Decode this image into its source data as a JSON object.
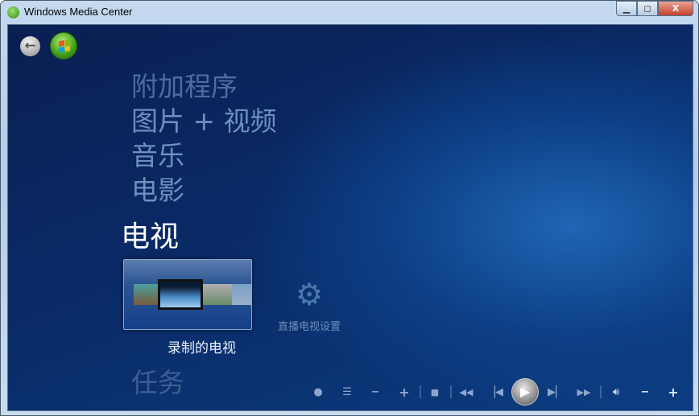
{
  "window": {
    "title": "Windows Media Center",
    "controls": {
      "minimize": "▭",
      "maximize": "□",
      "close": "X"
    }
  },
  "nav": {
    "back_icon": "back-arrow-icon",
    "start_icon": "windows-start-orb-icon"
  },
  "menu": {
    "items": [
      "附加程序",
      "图片 + 视频",
      "音乐",
      "电影"
    ],
    "selected": "电视",
    "next": "任务"
  },
  "strip": {
    "tiles": [
      {
        "label": "录制的电视",
        "selected": true
      },
      {
        "label": "直播电视设置",
        "selected": false
      }
    ]
  },
  "transport": {
    "buttons": [
      "record",
      "guide",
      "channel-down",
      "channel-up",
      "stop",
      "rewind",
      "previous",
      "play",
      "next",
      "fast-forward",
      "mute",
      "volume-down",
      "volume-up"
    ]
  }
}
